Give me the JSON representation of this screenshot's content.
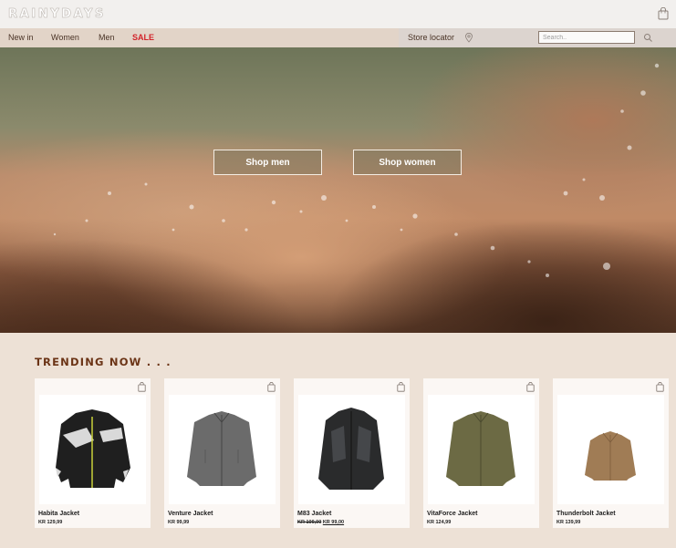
{
  "header": {
    "logo_text": "RAINYDAYS",
    "cart_icon": "shopping-bag-icon"
  },
  "nav": {
    "items": [
      {
        "label": "New in"
      },
      {
        "label": "Women"
      },
      {
        "label": "Men"
      },
      {
        "label": "SALE"
      }
    ],
    "store_locator": "Store locator",
    "search_placeholder": "Search..",
    "sale_color": "#d2232a"
  },
  "hero": {
    "shop_men": "Shop men",
    "shop_women": "Shop women"
  },
  "trending": {
    "title": "TRENDING NOW . . .",
    "products": [
      {
        "name": "Habita Jacket",
        "price": "KR 129,99",
        "color": "#1f1f1f"
      },
      {
        "name": "Venture Jacket",
        "price": "KR 99,99",
        "color": "#6b6b6b"
      },
      {
        "name": "M83 Jacket",
        "old_price": "KR 109,00",
        "price": "KR 99,00",
        "color": "#2a2b2c"
      },
      {
        "name": "VitaForce Jacket",
        "price": "KR 124,99",
        "color": "#6c6a44"
      },
      {
        "name": "Thunderbolt Jacket",
        "price": "KR 139,99",
        "color": "#a07c55"
      }
    ]
  },
  "colors": {
    "accent_heading": "#6b3416",
    "page_bg": "#ede1d6"
  }
}
